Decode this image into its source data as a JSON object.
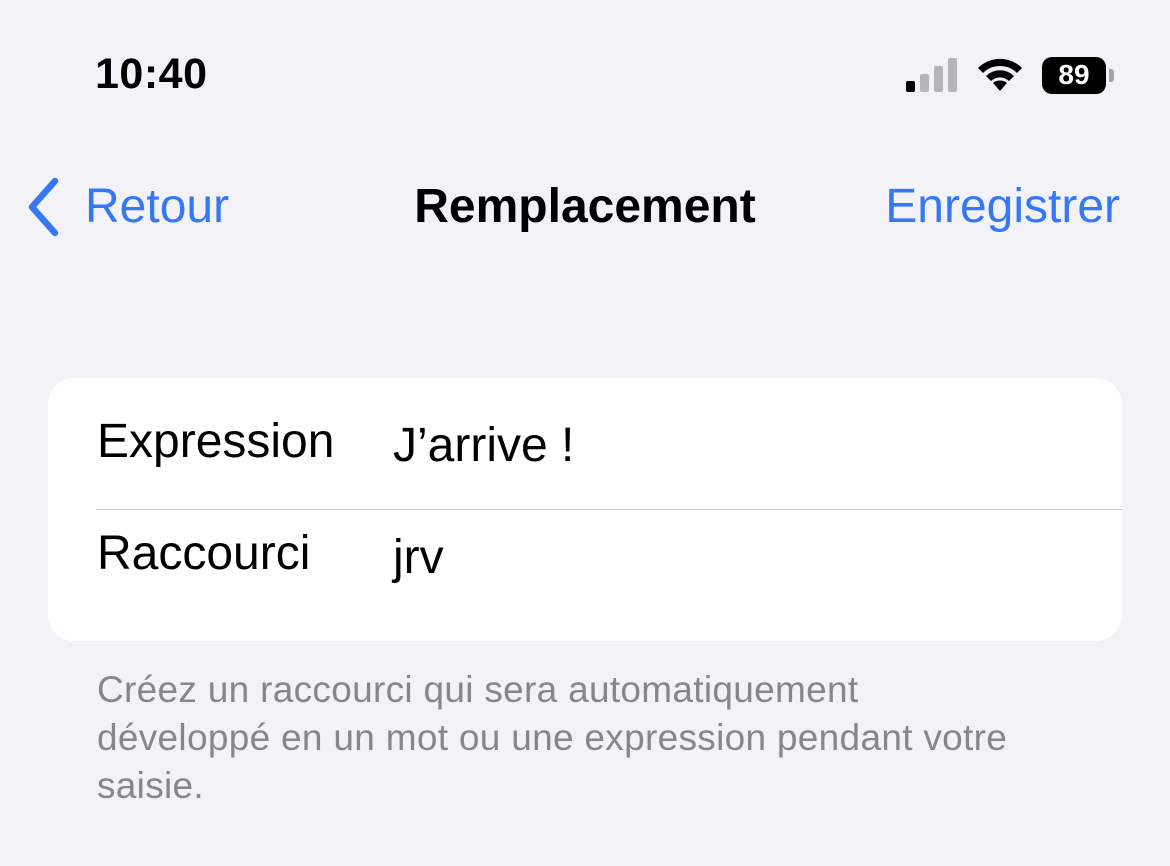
{
  "status_bar": {
    "time": "10:40",
    "signal_icon": "cellular-signal-icon",
    "wifi_icon": "wifi-icon",
    "battery_level": "89"
  },
  "nav": {
    "back_icon": "chevron-left-icon",
    "back_label": "Retour",
    "title": "Remplacement",
    "save_label": "Enregistrer"
  },
  "form": {
    "rows": [
      {
        "label": "Expression",
        "value": "J’arrive !"
      },
      {
        "label": "Raccourci",
        "value": "jrv"
      }
    ]
  },
  "footer": {
    "help_text": "Créez un raccourci qui sera automatiquement développé en un mot ou une expression pendant votre saisie."
  },
  "colors": {
    "accent": "#3478f6",
    "background": "#f2f2f7",
    "card": "#ffffff",
    "secondary_text": "#86868b",
    "separator": "#c6c6c8"
  }
}
